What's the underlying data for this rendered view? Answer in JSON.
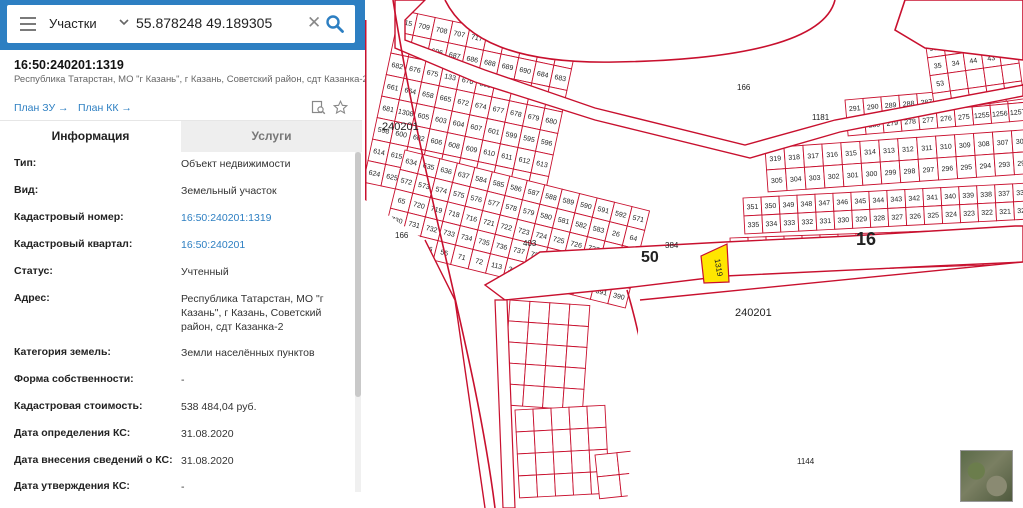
{
  "search": {
    "type_label": "Участки",
    "query": "55.878248 49.189305",
    "clear_glyph": "✕"
  },
  "parcel": {
    "title": "16:50:240201:1319",
    "address_line": "Республика Татарстан, МО \"г Казань\", г Казань, Советский район, сдт Казанка-2",
    "plan_zu": "План ЗУ →",
    "plan_kk": "План КК →"
  },
  "tabs": {
    "info": "Информация",
    "services": "Услуги"
  },
  "info_rows": [
    {
      "key": "Тип:",
      "value": "Объект недвижимости",
      "link": false
    },
    {
      "key": "Вид:",
      "value": "Земельный участок",
      "link": false
    },
    {
      "key": "Кадастровый номер:",
      "value": "16:50:240201:1319",
      "link": true
    },
    {
      "key": "Кадастровый квартал:",
      "value": "16:50:240201",
      "link": true
    },
    {
      "key": "Статус:",
      "value": "Учтенный",
      "link": false
    },
    {
      "key": "Адрес:",
      "value": "Республика Татарстан, МО \"г Казань\", г Казань, Советский район, сдт Казанка-2",
      "link": false
    },
    {
      "key": "Категория земель:",
      "value": "Земли населённых пунктов",
      "link": false
    },
    {
      "key": "Форма собственности:",
      "value": "-",
      "link": false
    },
    {
      "key": "Кадастровая стоимость:",
      "value": "538 484,04 руб.",
      "link": false
    },
    {
      "key": "Дата определения КС:",
      "value": "31.08.2020",
      "link": false
    },
    {
      "key": "Дата внесения сведений о КС:",
      "value": "31.08.2020",
      "link": false
    },
    {
      "key": "Дата утверждения КС:",
      "value": "-",
      "link": false
    }
  ],
  "icons": {
    "menu": "hamburger-menu-icon",
    "dropdown": "chevron-down-icon",
    "clear": "close-icon",
    "search": "search-icon",
    "plan_tool": "document-search-icon",
    "favorite": "star-icon",
    "collapse": "chevron-left-icon"
  },
  "colors": {
    "accent": "#2d7fc2",
    "boundary": "#c8102e",
    "selected_parcel": "#ffe600",
    "road_fill": "#ffffff"
  },
  "map": {
    "selected_parcel_label": "1319",
    "quarter_labels": [
      "240201",
      "240201",
      "240201"
    ],
    "district_labels": [
      "50",
      "16"
    ],
    "parcel_labels": [
      "166",
      "166",
      "1144",
      "1181",
      "403",
      "384",
      "715",
      "709",
      "708",
      "707",
      "717",
      "701",
      "702",
      "703",
      "697",
      "699",
      "694",
      "695",
      "696",
      "687",
      "686",
      "688",
      "689",
      "690",
      "684",
      "683",
      "682",
      "676",
      "675",
      "133",
      "670",
      "669",
      "668",
      "667",
      "666",
      "660",
      "661",
      "664",
      "658",
      "665",
      "672",
      "674",
      "677",
      "678",
      "679",
      "680",
      "681",
      "1308",
      "605",
      "603",
      "604",
      "607",
      "601",
      "599",
      "595",
      "596",
      "598",
      "600",
      "602",
      "606",
      "608",
      "609",
      "610",
      "611",
      "612",
      "613",
      "614",
      "615",
      "616",
      "617",
      "618",
      "619",
      "620",
      "621",
      "622",
      "623",
      "624",
      "625",
      "626",
      "627",
      "628",
      "629",
      "630",
      "631",
      "632",
      "633",
      "634",
      "635",
      "636",
      "637",
      "584",
      "585",
      "586",
      "587",
      "588",
      "589",
      "590",
      "591",
      "592",
      "571",
      "572",
      "573",
      "574",
      "575",
      "576",
      "577",
      "578",
      "579",
      "580",
      "581",
      "582",
      "583",
      "26",
      "64",
      "65",
      "720",
      "719",
      "718",
      "716",
      "721",
      "722",
      "723",
      "724",
      "725",
      "726",
      "727",
      "728",
      "729",
      "730",
      "731",
      "732",
      "733",
      "734",
      "735",
      "736",
      "737",
      "738",
      "739",
      "740",
      "741",
      "742",
      "743",
      "744",
      "537",
      "536",
      "55",
      "71",
      "72",
      "113",
      "398",
      "397",
      "395",
      "396",
      "392",
      "391",
      "390",
      "389",
      "388",
      "387",
      "386",
      "385",
      "383",
      "382",
      "381",
      "380",
      "379",
      "378",
      "377",
      "376",
      "375",
      "374",
      "373",
      "372",
      "371",
      "370",
      "369",
      "368",
      "367",
      "366",
      "365",
      "364",
      "363",
      "362",
      "361",
      "360",
      "359",
      "358",
      "357",
      "356",
      "355",
      "354",
      "353",
      "352",
      "351",
      "350",
      "349",
      "348",
      "347",
      "346",
      "345",
      "344",
      "343",
      "342",
      "341",
      "340",
      "339",
      "338",
      "337",
      "336",
      "335",
      "334",
      "333",
      "332",
      "331",
      "330",
      "329",
      "328",
      "327",
      "326",
      "325",
      "324",
      "323",
      "322",
      "321",
      "320",
      "319",
      "318",
      "317",
      "316",
      "315",
      "314",
      "313",
      "312",
      "311",
      "310",
      "309",
      "308",
      "307",
      "306",
      "305",
      "304",
      "303",
      "302",
      "301",
      "300",
      "299",
      "298",
      "297",
      "296",
      "295",
      "294",
      "293",
      "292",
      "291",
      "290",
      "289",
      "288",
      "287",
      "286",
      "285",
      "284",
      "283",
      "282",
      "281",
      "280",
      "279",
      "278",
      "277",
      "276",
      "275",
      "1255",
      "1256",
      "1257",
      "930",
      "400",
      "401",
      "135",
      "36",
      "35",
      "34",
      "44",
      "43",
      "48",
      "53"
    ]
  }
}
